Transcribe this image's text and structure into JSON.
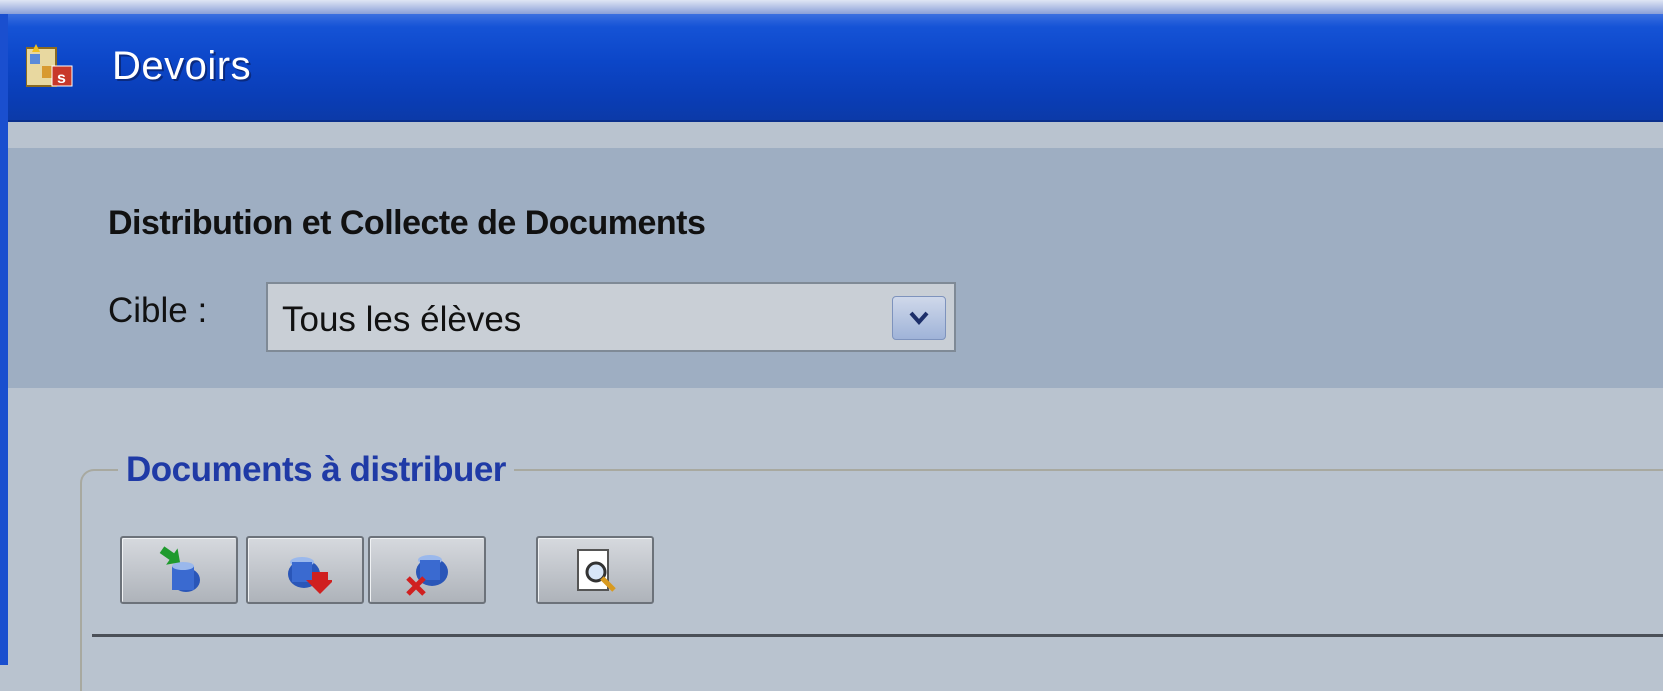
{
  "window": {
    "title": "Devoirs",
    "title_icon": "app-icon"
  },
  "header": {
    "title": "Distribution et Collecte de Documents",
    "target_label": "Cible :",
    "target_value": "Tous les élèves"
  },
  "group": {
    "title": "Documents à distribuer",
    "toolbar": [
      {
        "name": "add-document-button",
        "icon": "add-document-icon"
      },
      {
        "name": "collect-document-button",
        "icon": "collect-document-icon"
      },
      {
        "name": "remove-document-button",
        "icon": "remove-document-icon"
      },
      {
        "name": "preview-document-button",
        "icon": "preview-document-icon"
      }
    ]
  },
  "colors": {
    "titlebar": "#0c46c8",
    "header_panel": "#9eaec2",
    "background": "#b9c3cf",
    "group_title": "#1f3aa6"
  }
}
